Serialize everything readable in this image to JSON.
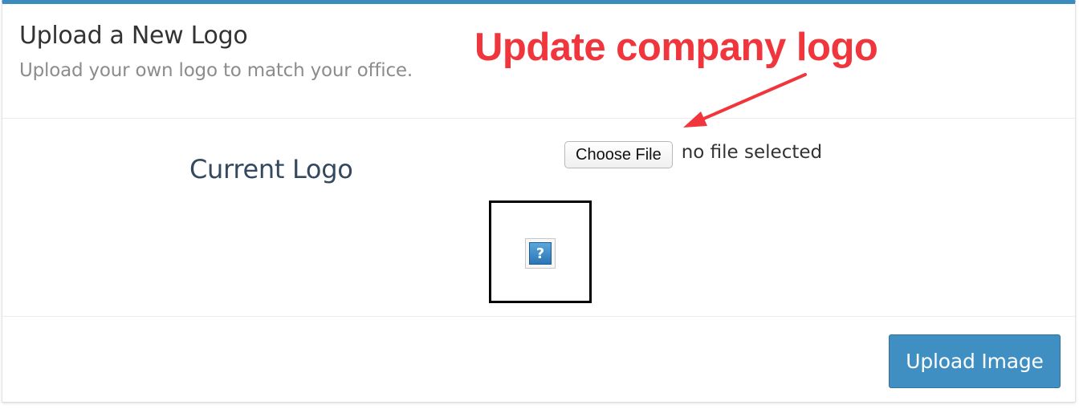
{
  "header": {
    "title": "Upload a New Logo",
    "subtitle": "Upload your own logo to match your office."
  },
  "annotation": {
    "text": "Update company logo",
    "color": "#f0363c"
  },
  "body": {
    "current_logo_label": "Current Logo",
    "file_input": {
      "button_label": "Choose File",
      "status": "no file selected"
    },
    "logo_preview": {
      "placeholder_glyph": "?",
      "icon": "broken-image-icon"
    }
  },
  "footer": {
    "upload_label": "Upload Image"
  },
  "colors": {
    "accent": "#3b8bbf",
    "button": "#3f8fc2"
  }
}
